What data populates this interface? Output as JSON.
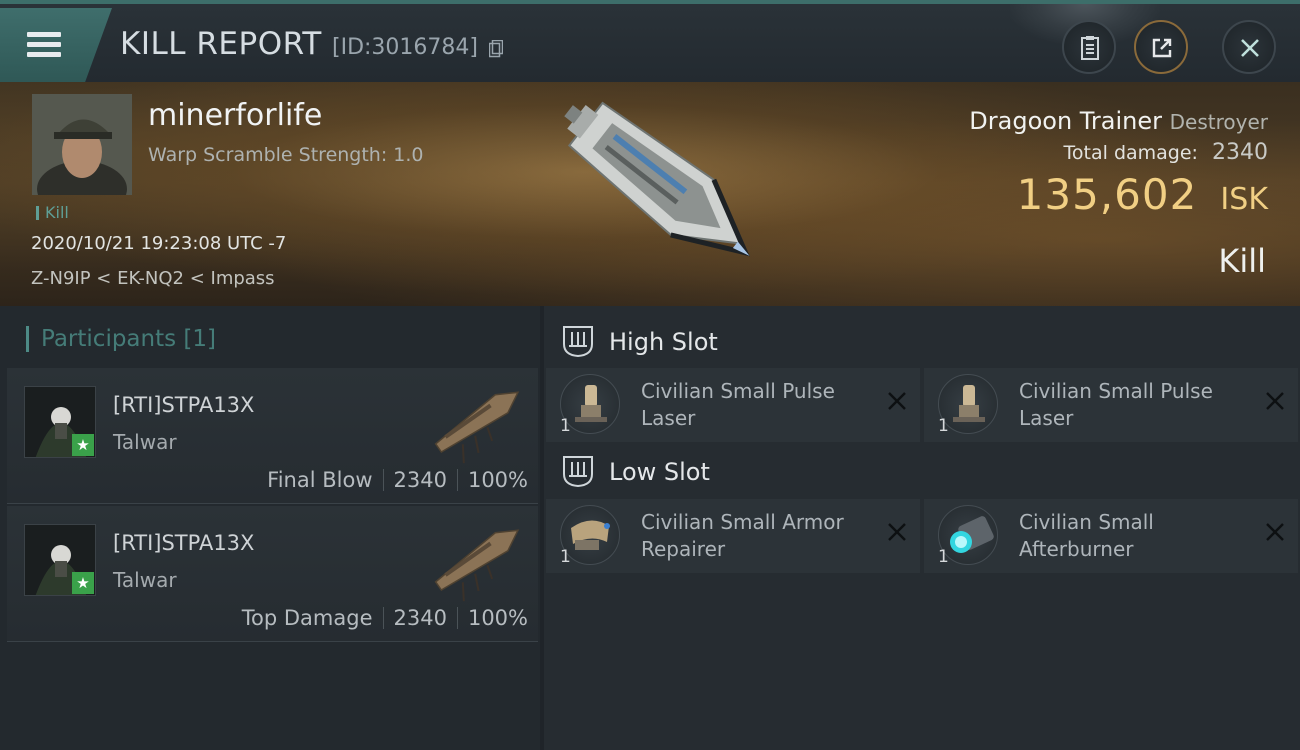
{
  "window": {
    "title": "KILL REPORT",
    "id_label": "[ID:3016784]"
  },
  "victim": {
    "pilot_name": "minerforlife",
    "warp_scramble": "Warp Scramble Strength: 1.0",
    "tag": "Kill",
    "datetime": "2020/10/21 19:23:08 UTC -7",
    "location": "Z-N9IP < EK-NQ2 < Impass",
    "ship_name": "Dragoon Trainer",
    "ship_class": "Destroyer",
    "total_damage_label": "Total damage:",
    "total_damage": "2340",
    "isk_value": "135,602",
    "isk_unit": "ISK",
    "status": "Kill"
  },
  "participants": {
    "header": "Participants [1]",
    "items": [
      {
        "name": "[RTI]STPA13X",
        "ship": "Talwar",
        "role": "Final Blow",
        "damage": "2340",
        "percent": "100%"
      },
      {
        "name": "[RTI]STPA13X",
        "ship": "Talwar",
        "role": "Top Damage",
        "damage": "2340",
        "percent": "100%"
      }
    ]
  },
  "slots": {
    "high": {
      "title": "High Slot",
      "modules": [
        {
          "name": "Civilian Small Pulse Laser",
          "qty": "1",
          "icon": "pulse-laser-icon"
        },
        {
          "name": "Civilian Small Pulse Laser",
          "qty": "1",
          "icon": "pulse-laser-icon"
        }
      ]
    },
    "low": {
      "title": "Low Slot",
      "modules": [
        {
          "name": "Civilian Small Armor Repairer",
          "qty": "1",
          "icon": "armor-repairer-icon"
        },
        {
          "name": "Civilian Small Afterburner",
          "qty": "1",
          "icon": "afterburner-icon"
        }
      ]
    }
  },
  "colors": {
    "accent_teal": "#4d8a86",
    "isk_gold": "#f1cf84",
    "star_green": "#3aa14a"
  }
}
